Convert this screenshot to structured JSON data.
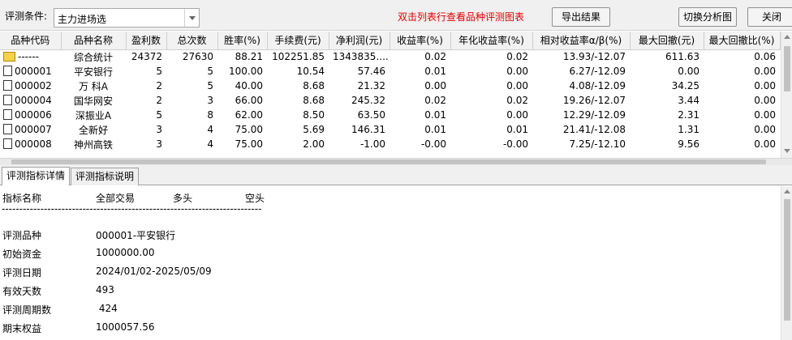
{
  "toolbar": {
    "condition_label": "评测条件:",
    "condition_value": "主力进场选",
    "hint": "双击列表行查看品种评测图表",
    "export_label": "导出结果",
    "switch_label": "切换分析图",
    "close_label": "关闭"
  },
  "table": {
    "headers": [
      "品种代码",
      "品种名称",
      "盈利数",
      "总次数",
      "胜率(%)",
      "手续费(元)",
      "净利润(元)",
      "收益率(%)",
      "年化收益率(%)",
      "相对收益率α/β(%)",
      "最大回撤(元)",
      "最大回撤比(%)"
    ],
    "rows": [
      {
        "code": "------",
        "name": "综合统计",
        "win": "24372",
        "total": "27630",
        "rate": "88.21",
        "fee": "102251.85",
        "profit": "1343835....",
        "ret": "0.02",
        "annual": "0.02",
        "rel": "13.93/-12.07",
        "dd": "611.63",
        "ddr": "0.06"
      },
      {
        "code": "000001",
        "name": "平安银行",
        "win": "5",
        "total": "5",
        "rate": "100.00",
        "fee": "10.54",
        "profit": "57.46",
        "ret": "0.01",
        "annual": "0.00",
        "rel": "6.27/-12.09",
        "dd": "0.00",
        "ddr": "0.00"
      },
      {
        "code": "000002",
        "name": "万 科A",
        "win": "2",
        "total": "5",
        "rate": "40.00",
        "fee": "8.68",
        "profit": "21.32",
        "ret": "0.00",
        "annual": "0.00",
        "rel": "4.08/-12.09",
        "dd": "34.25",
        "ddr": "0.00"
      },
      {
        "code": "000004",
        "name": "国华网安",
        "win": "2",
        "total": "3",
        "rate": "66.00",
        "fee": "8.68",
        "profit": "245.32",
        "ret": "0.02",
        "annual": "0.02",
        "rel": "19.26/-12.07",
        "dd": "3.44",
        "ddr": "0.00"
      },
      {
        "code": "000006",
        "name": "深振业A",
        "win": "5",
        "total": "8",
        "rate": "62.00",
        "fee": "8.50",
        "profit": "63.50",
        "ret": "0.01",
        "annual": "0.00",
        "rel": "12.29/-12.09",
        "dd": "2.31",
        "ddr": "0.00"
      },
      {
        "code": "000007",
        "name": "全新好",
        "win": "3",
        "total": "4",
        "rate": "75.00",
        "fee": "5.69",
        "profit": "146.31",
        "ret": "0.01",
        "annual": "0.01",
        "rel": "21.41/-12.08",
        "dd": "1.31",
        "ddr": "0.00"
      },
      {
        "code": "000008",
        "name": "神州高铁",
        "win": "3",
        "total": "4",
        "rate": "75.00",
        "fee": "2.00",
        "profit": "-1.00",
        "ret": "-0.00",
        "annual": "-0.00",
        "rel": "7.25/-12.10",
        "dd": "9.56",
        "ddr": "0.00"
      }
    ]
  },
  "tabs": [
    "评测指标详情",
    "评测指标说明"
  ],
  "detail": {
    "headers": [
      "指标名称",
      "全部交易",
      "多头",
      "空头"
    ],
    "divider": "--------------------------------------------------------------------------",
    "rows": [
      {
        "key": "评测品种",
        "value": "000001-平安银行"
      },
      {
        "key": "初始资金",
        "value": "1000000.00"
      },
      {
        "key": "评测日期",
        "value": "2024/01/02-2025/05/09"
      },
      {
        "key": "有效天数",
        "value": "493"
      },
      {
        "key": "评测周期数",
        "value": " 424"
      },
      {
        "key": "期末权益",
        "value": "1000057.56"
      }
    ]
  }
}
